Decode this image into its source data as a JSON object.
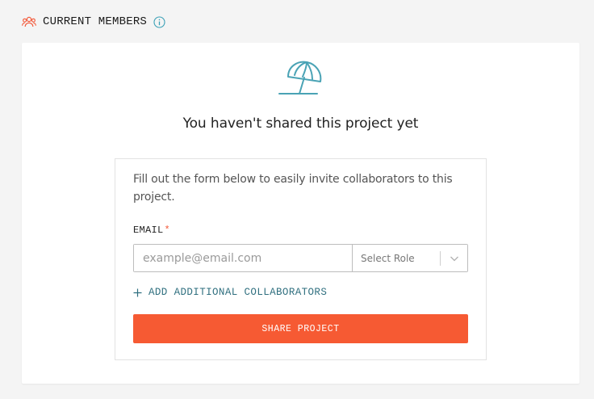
{
  "header": {
    "title": "CURRENT MEMBERS",
    "members_icon": "people-icon",
    "info_icon": "info-icon"
  },
  "empty_state": {
    "illustration": "beach-umbrella-icon",
    "title": "You haven't shared this project yet"
  },
  "invite_form": {
    "description": "Fill out the form below to easily invite collaborators to this project.",
    "email_label": "EMAIL",
    "required_marker": "*",
    "email_value": "",
    "email_placeholder": "example@email.com",
    "role_select_value": "Select Role",
    "add_collaborators_label": "ADD ADDITIONAL COLLABORATORS",
    "share_button_label": "SHARE PROJECT"
  },
  "colors": {
    "accent_orange": "#f65a33",
    "teal": "#4aa3b5",
    "link_teal": "#2f6f7f",
    "background": "#f4f4f4"
  }
}
